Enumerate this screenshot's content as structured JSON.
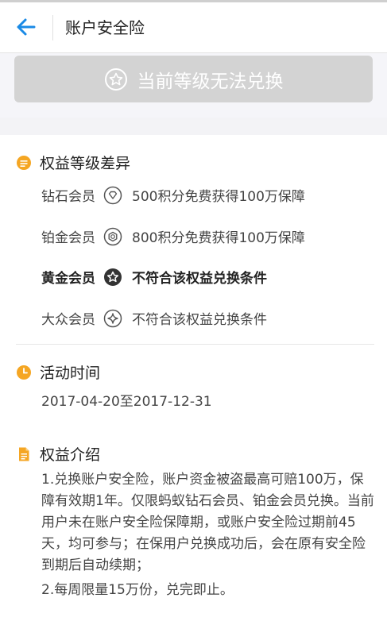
{
  "header": {
    "title": "账户安全险"
  },
  "redeem_button": {
    "label": "当前等级无法兑换"
  },
  "tiers_section": {
    "title": "权益等级差异",
    "tiers": [
      {
        "name": "钻石会员",
        "desc": "500积分免费获得100万保障",
        "icon": "diamond-icon"
      },
      {
        "name": "铂金会员",
        "desc": "800积分免费获得100万保障",
        "icon": "hexagon-icon"
      },
      {
        "name": "黄金会员",
        "desc": "不符合该权益兑换条件",
        "icon": "star-badge-icon"
      },
      {
        "name": "大众会员",
        "desc": "不符合该权益兑换条件",
        "icon": "sparkle-icon"
      }
    ]
  },
  "time_section": {
    "title": "活动时间",
    "range": "2017-04-20至2017-12-31"
  },
  "intro_section": {
    "title": "权益介绍",
    "paragraphs": [
      "1.兑换账户安全险，账户资金被盗最高可赔100万，保障有效期1年。仅限蚂蚁钻石会员、铂金会员兑换。当前用户未在账户安全险保障期，或账户安全险过期前45天，均可参与；在保用户兑换成功后，会在原有安全险到期后自动续期；",
      "2.每周限量15万份，兑完即止。"
    ]
  },
  "colors": {
    "accent_blue": "#1a8ae6",
    "section_orange": "#f5a623",
    "button_disabled": "#d3d3d3"
  }
}
